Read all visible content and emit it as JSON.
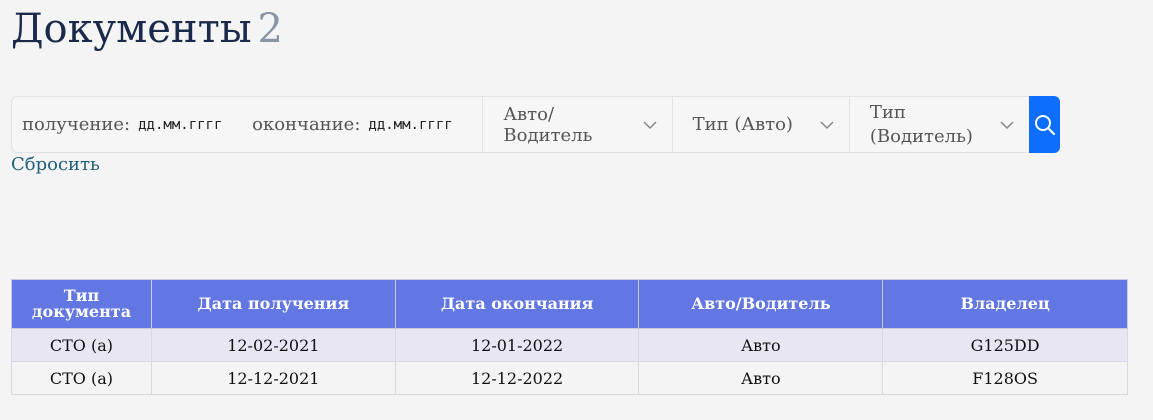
{
  "page": {
    "title": "Документы",
    "count": "2"
  },
  "filters": {
    "received_label": "получение:",
    "received_placeholder": "дд.мм.гггг",
    "end_label": "окончание:",
    "end_placeholder": "дд.мм.гггг",
    "selects": [
      {
        "value": "Авто/Водитель"
      },
      {
        "value": "Тип (Авто)"
      },
      {
        "value": "Тип (Водитель)"
      }
    ],
    "search_icon": "search-icon",
    "accent_color": "#0d6efd",
    "reset_label": "Сбросить"
  },
  "table": {
    "header_color": "#6277e2",
    "columns": [
      "Тип документа",
      "Дата получения",
      "Дата окончания",
      "Авто/Водитель",
      "Владелец"
    ],
    "rows": [
      [
        "СТО (а)",
        "12-02-2021",
        "12-01-2022",
        "Авто",
        "G125DD"
      ],
      [
        "СТО (а)",
        "12-12-2021",
        "12-12-2022",
        "Авто",
        "F128OS"
      ]
    ]
  }
}
